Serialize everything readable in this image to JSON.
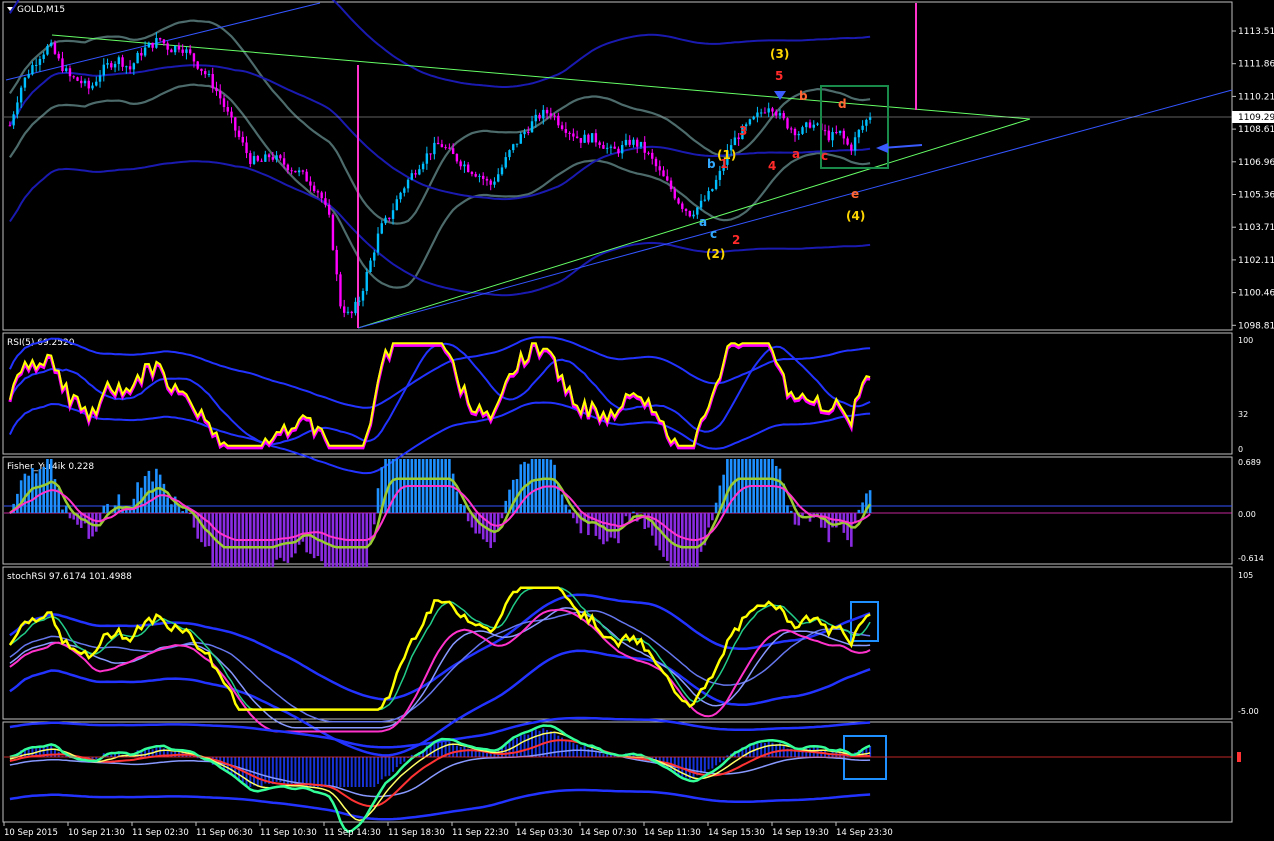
{
  "header": {
    "symbol_label": "GOLD,M15",
    "menu_icon": "triangle-down-icon"
  },
  "colors": {
    "background": "#000000",
    "frame": "#c0c0c0",
    "bull_candle": "#00bfff",
    "bear_candle": "#ff00ff",
    "bands": "#4d6b6b",
    "channel": "#1a1ab0",
    "trend_green": "#66ff66",
    "trend_blue": "#3355ff",
    "rsi_main": "#ffff00",
    "rsi_shadow": "#ff00ff",
    "fisher_pos": "#1e90ff",
    "fisher_neg": "#8a2be2",
    "annotation_box_green": "#1a8a4a",
    "annotation_box_blue": "#1e90ff",
    "wave_yellow": "#ffd700",
    "wave_red": "#ff2a2a",
    "wave_cyan": "#33aaff",
    "wave_orange": "#ff6633",
    "current_price_line": "#c0c0c0"
  },
  "price_axis": {
    "labels": [
      "1113.51",
      "1111.86",
      "1110.21",
      "1108.61",
      "1106.96",
      "1105.36",
      "1103.71",
      "1102.11",
      "1100.46",
      "1098.81"
    ],
    "current_price": "1109.29"
  },
  "time_axis": {
    "labels": [
      "10 Sep 2015",
      "10 Sep 21:30",
      "11 Sep 02:30",
      "11 Sep 06:30",
      "11 Sep 10:30",
      "11 Sep 14:30",
      "11 Sep 18:30",
      "11 Sep 22:30",
      "14 Sep 03:30",
      "14 Sep 07:30",
      "14 Sep 11:30",
      "14 Sep 15:30",
      "14 Sep 19:30",
      "14 Sep 23:30"
    ]
  },
  "wave_labels": [
    {
      "text": "(3)",
      "color": "wave_yellow"
    },
    {
      "text": "5",
      "color": "wave_red"
    },
    {
      "text": "b",
      "color": "wave_orange"
    },
    {
      "text": "d",
      "color": "wave_orange"
    },
    {
      "text": "3",
      "color": "wave_red"
    },
    {
      "text": "(1)",
      "color": "wave_yellow"
    },
    {
      "text": "b",
      "color": "wave_cyan"
    },
    {
      "text": "1",
      "color": "wave_red"
    },
    {
      "text": "4",
      "color": "wave_red"
    },
    {
      "text": "a",
      "color": "wave_red"
    },
    {
      "text": "c",
      "color": "wave_red"
    },
    {
      "text": "a",
      "color": "wave_cyan"
    },
    {
      "text": "c",
      "color": "wave_cyan"
    },
    {
      "text": "2",
      "color": "wave_red"
    },
    {
      "text": "(2)",
      "color": "wave_yellow"
    },
    {
      "text": "e",
      "color": "wave_orange"
    },
    {
      "text": "(4)",
      "color": "wave_yellow"
    }
  ],
  "panels": {
    "rsi": {
      "title": "RSI(5) 69.2520",
      "scale": [
        "100",
        "32",
        "0"
      ]
    },
    "fisher": {
      "title": "Fisher_Yur4ik 0.228",
      "scale": [
        "0.689",
        "0.00",
        "-0.614"
      ]
    },
    "stoch": {
      "title": "stochRSI 97.6174 101.4988",
      "scale": [
        "105",
        "-5.00"
      ]
    },
    "osc": {
      "title": "",
      "scale": []
    }
  },
  "chart_data": {
    "type": "candlestick",
    "symbol": "GOLD",
    "timeframe": "M15",
    "ylim": [
      1098.3,
      1114.6
    ],
    "close_path": [
      1108.8,
      1110.6,
      1111.6,
      1112.3,
      1112.8,
      1111.9,
      1111.2,
      1111.0,
      1110.6,
      1111.4,
      1111.9,
      1112.1,
      1111.6,
      1112.4,
      1112.8,
      1113.1,
      1112.6,
      1112.8,
      1112.3,
      1111.7,
      1111.1,
      1110.2,
      1109.1,
      1108.1,
      1107.1,
      1106.9,
      1107.3,
      1107.0,
      1106.7,
      1106.4,
      1106.0,
      1105.4,
      1104.0,
      1099.9,
      1099.2,
      1100.2,
      1101.9,
      1103.6,
      1104.3,
      1105.4,
      1106.2,
      1106.9,
      1107.5,
      1107.9,
      1107.4,
      1107.0,
      1106.6,
      1106.3,
      1105.8,
      1106.5,
      1107.5,
      1108.2,
      1108.8,
      1109.3,
      1109.5,
      1108.9,
      1108.5,
      1108.1,
      1108.2,
      1108.0,
      1107.5,
      1107.6,
      1108.0,
      1107.8,
      1107.2,
      1106.4,
      1105.7,
      1104.9,
      1104.4,
      1104.8,
      1105.4,
      1106.4,
      1107.8,
      1108.4,
      1108.9,
      1109.4,
      1109.9,
      1109.2,
      1108.7,
      1108.4,
      1108.9,
      1108.6,
      1108.2,
      1108.4,
      1107.6,
      1108.6,
      1109.3
    ],
    "annotation_boxes": 3
  }
}
